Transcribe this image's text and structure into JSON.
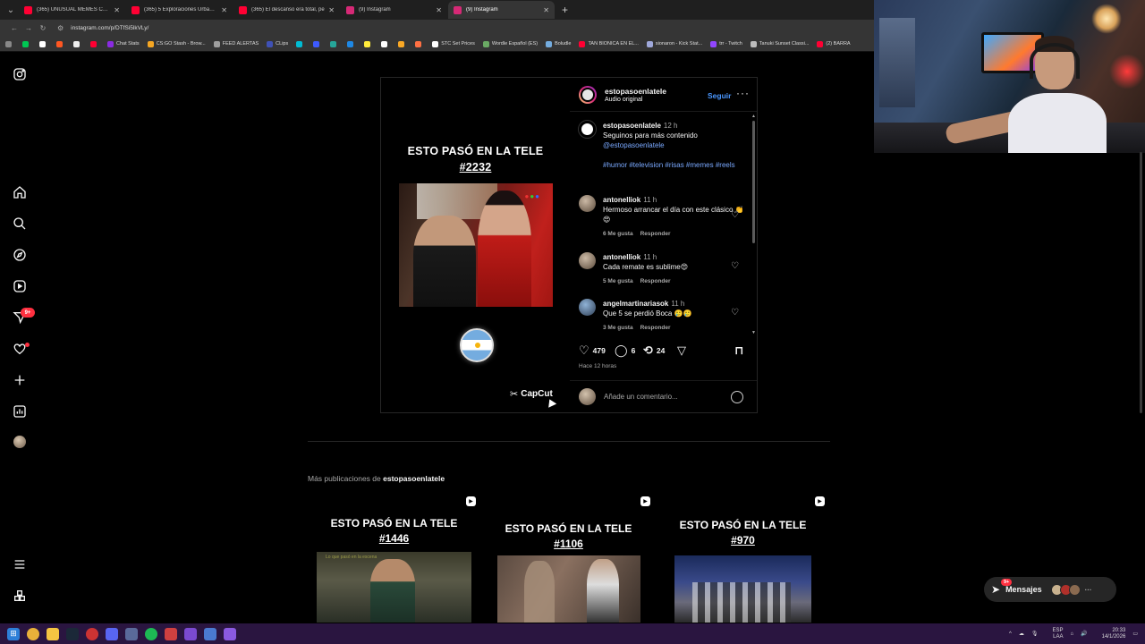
{
  "browser": {
    "tabs": [
      {
        "title": "(365) UNUSUAL MEMES COMP",
        "color": "#ff0033"
      },
      {
        "title": "(365) 5 Exploraciones Urbanas",
        "color": "#ff0033"
      },
      {
        "title": "(365) El descanso era total, pe",
        "color": "#ff0033"
      },
      {
        "title": "(9) Instagram",
        "color": "#d62976"
      },
      {
        "title": "(9) Instagram",
        "color": "#d62976"
      }
    ],
    "url": "instagram.com/p/DTfSi5lkVLy/",
    "bookmarks": [
      {
        "label": "",
        "color": "#00c853"
      },
      {
        "label": "",
        "color": "#ffffff"
      },
      {
        "label": "",
        "color": "#ff5722"
      },
      {
        "label": "",
        "color": "#eeeeee"
      },
      {
        "label": "",
        "color": "#ff0033"
      },
      {
        "label": "Chat Stats",
        "color": "#8a2be2"
      },
      {
        "label": "CS:GO Stash - Brow...",
        "color": "#f5a623"
      },
      {
        "label": "FEED ALERTAS",
        "color": "#9e9e9e"
      },
      {
        "label": "CLips",
        "color": "#3f51b5"
      },
      {
        "label": "",
        "color": "#00bcd4"
      },
      {
        "label": "",
        "color": "#3d5afe"
      },
      {
        "label": "",
        "color": "#26a69a"
      },
      {
        "label": "",
        "color": "#1e88e5"
      },
      {
        "label": "",
        "color": "#ffeb3b"
      },
      {
        "label": "",
        "color": "#ffffff"
      },
      {
        "label": "",
        "color": "#f9a825"
      },
      {
        "label": "",
        "color": "#ff7043"
      },
      {
        "label": "STC Set Prices",
        "color": "#ffffff"
      },
      {
        "label": "Wordle Español (ES)",
        "color": "#6aaa64"
      },
      {
        "label": "Boludle",
        "color": "#74acdf"
      },
      {
        "label": "TAN BIONICA EN EL...",
        "color": "#ff0033"
      },
      {
        "label": "sionaron - Kick Stat...",
        "color": "#9fa8da"
      },
      {
        "label": "trr - Twitch",
        "color": "#9146ff"
      },
      {
        "label": "Tanuki Sunset Classi...",
        "color": "#bdbdbd"
      },
      {
        "label": "(2) BARRA",
        "color": "#ff0033"
      }
    ]
  },
  "sidebar": {
    "items": [
      {
        "icon": "instagram-logo-icon"
      },
      {
        "icon": "home-icon"
      },
      {
        "icon": "search-icon"
      },
      {
        "icon": "explore-icon"
      },
      {
        "icon": "reels-icon"
      },
      {
        "icon": "messages-icon",
        "badge": "9+"
      },
      {
        "icon": "notifications-icon"
      },
      {
        "icon": "create-icon"
      },
      {
        "icon": "dashboard-icon"
      },
      {
        "icon": "profile-avatar"
      },
      {
        "icon": "menu-icon"
      },
      {
        "icon": "also-from-meta-icon"
      }
    ]
  },
  "post": {
    "username": "estopasoenlatele",
    "audio": "Audio original",
    "follow": "Seguir",
    "media": {
      "title_line1": "ESTO PASÓ EN LA TELE",
      "title_line2": "#2232",
      "watermark": "CapCut"
    },
    "caption": {
      "username": "estopasoenlatele",
      "time": "12 h",
      "text": "Seguinos para más contenido",
      "mention": "@estopasoenlatele",
      "hashtags": "#humor #television #risas #memes #reels"
    },
    "comments": [
      {
        "username": "antonelliok",
        "time": "11 h",
        "text": "Hermoso arrancar el día con este clásico 👏😍",
        "likes": "6 Me gusta",
        "reply": "Responder"
      },
      {
        "username": "antonelliok",
        "time": "11 h",
        "text": "Cada remate es sublime😍",
        "likes": "5 Me gusta",
        "reply": "Responder"
      },
      {
        "username": "angelmartinariasok",
        "time": "11 h",
        "text": "Que 5 se perdió Boca 🥲🥲",
        "likes": "3 Me gusta",
        "reply": "Responder"
      }
    ],
    "stats": {
      "likes": "479",
      "comments": "6",
      "reposts": "24"
    },
    "posted": "Hace 12 horas",
    "add_comment_placeholder": "Añade un comentario..."
  },
  "more": {
    "prefix": "Más publicaciones de",
    "username": "estopasoenlatele",
    "posts": [
      {
        "line1": "ESTO PASÓ EN LA TELE",
        "line2": "#1446",
        "overlay": "Lo que pasó en la escena"
      },
      {
        "line1": "ESTO PASÓ EN LA TELE",
        "line2": "#1106"
      },
      {
        "line1": "ESTO PASÓ EN LA TELE",
        "line2": "#970"
      }
    ]
  },
  "messages": {
    "label": "Mensajes",
    "badge": "9+"
  },
  "taskbar": {
    "lang1": "ESP",
    "lang2": "LAA",
    "time": "20:33",
    "date": "14/1/2026"
  }
}
